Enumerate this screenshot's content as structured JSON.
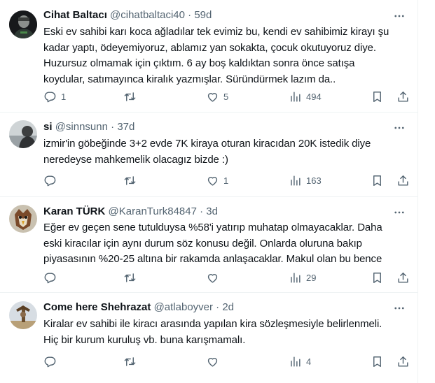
{
  "tweets": [
    {
      "name": "Cihat Baltacı",
      "handle": "@cihatbaltaci40",
      "time": "59d",
      "lines": [
        "Eski ev sahibi karı koca ağladılar tek evimiz bu, kendi ev sahibimiz kirayı şu",
        "kadar yaptı, ödeyemiyoruz, ablamız yan sokakta, çocuk okutuyoruz diye.",
        "Huzursuz olmamak için çıktım. 6 ay boş kaldıktan sonra önce satışa",
        "koydular, satımayınca kiralık yazmışlar. Süründürmek lazım da.."
      ],
      "replies": "1",
      "retweets": "",
      "likes": "5",
      "views": "494"
    },
    {
      "name": "si",
      "handle": "@sinnsunn",
      "time": "37d",
      "lines": [
        "izmir'in göbeğinde 3+2 evde 7K kiraya oturan kiracıdan 20K istedik diye",
        "neredeyse mahkemelik olacagız bizde :)"
      ],
      "replies": "",
      "retweets": "",
      "likes": "1",
      "views": "163"
    },
    {
      "name": "Karan TÜRK",
      "handle": "@KaranTurk84847",
      "time": "3d",
      "lines": [
        "Eğer ev geçen sene tutulduysa %58'i yatırıp muhatap olmayacaklar. Daha",
        "eski kiracılar için aynı durum söz konusu değil. Onlarda oluruna bakıp",
        "piyasasının %20-25 altına bir rakamda anlaşacaklar. Makul olan bu bence"
      ],
      "replies": "",
      "retweets": "",
      "likes": "",
      "views": "29"
    },
    {
      "name": "Come here Shehrazat",
      "handle": "@atlaboyver",
      "time": "2d",
      "lines": [
        "Kiralar ev sahibi ile kiracı arasında yapılan kira sözleşmesiyle belirlenmeli.",
        "Hiç bir kurum kuruluş vb. buna karışmamalı."
      ],
      "replies": "",
      "retweets": "",
      "likes": "",
      "views": "4"
    }
  ],
  "separator": "·",
  "icons": {
    "more": "more-horizontal-icon",
    "reply": "reply-bubble-icon",
    "retweet": "retweet-icon",
    "like": "heart-icon",
    "views": "views-bar-chart-icon",
    "bookmark": "bookmark-icon",
    "share": "share-upload-icon"
  },
  "colors": {
    "text": "#0f1419",
    "secondary": "#536471",
    "border": "#eff3f4"
  }
}
